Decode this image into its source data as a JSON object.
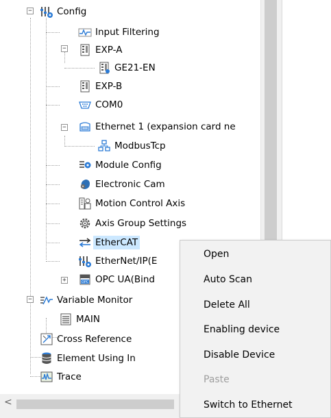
{
  "tree": {
    "items": [
      {
        "label": "Config",
        "icon": "config-icon"
      },
      {
        "label": "Input Filtering",
        "icon": "waveform-icon"
      },
      {
        "label": "EXP-A",
        "icon": "expansion-module-icon"
      },
      {
        "label": "GE21-EN",
        "icon": "expansion-module-icon"
      },
      {
        "label": "EXP-B",
        "icon": "expansion-module-icon"
      },
      {
        "label": "COM0",
        "icon": "serial-port-icon"
      },
      {
        "label": "Ethernet 1 (expansion card ne",
        "icon": "ethernet-card-icon"
      },
      {
        "label": "ModbusTcp",
        "icon": "network-nodes-icon"
      },
      {
        "label": "Module Config",
        "icon": "module-config-icon"
      },
      {
        "label": "Electronic Cam",
        "icon": "cam-icon"
      },
      {
        "label": "Motion Control Axis",
        "icon": "motion-axis-icon"
      },
      {
        "label": "Axis Group Settings",
        "icon": "gear-icon"
      },
      {
        "label": "EtherCAT",
        "icon": "ethercat-arrows-icon"
      },
      {
        "label": "EtherNet/IP(E",
        "icon": "ethernet-ip-icon"
      },
      {
        "label": "OPC UA(Bind",
        "icon": "opc-icon"
      },
      {
        "label": "Variable Monitor",
        "icon": "variable-monitor-icon"
      },
      {
        "label": "MAIN",
        "icon": "document-icon"
      },
      {
        "label": "Cross Reference",
        "icon": "cross-reference-icon"
      },
      {
        "label": "Element Using In",
        "icon": "database-icon"
      },
      {
        "label": "Trace",
        "icon": "trace-icon"
      }
    ]
  },
  "context_menu": {
    "items": [
      {
        "label": "Open",
        "enabled": true
      },
      {
        "label": "Auto Scan",
        "enabled": true
      },
      {
        "label": "Delete All",
        "enabled": true
      },
      {
        "label": "Enabling device",
        "enabled": true
      },
      {
        "label": "Disable Device",
        "enabled": true
      },
      {
        "label": "Paste",
        "enabled": false
      },
      {
        "label": "Switch to Ethernet",
        "enabled": true
      }
    ]
  },
  "scrollbar": {
    "left_arrow": "<"
  },
  "colors": {
    "selection": "#cce8ff",
    "menu_bg": "#f2f2f2",
    "disabled_text": "#9e9e9e"
  }
}
